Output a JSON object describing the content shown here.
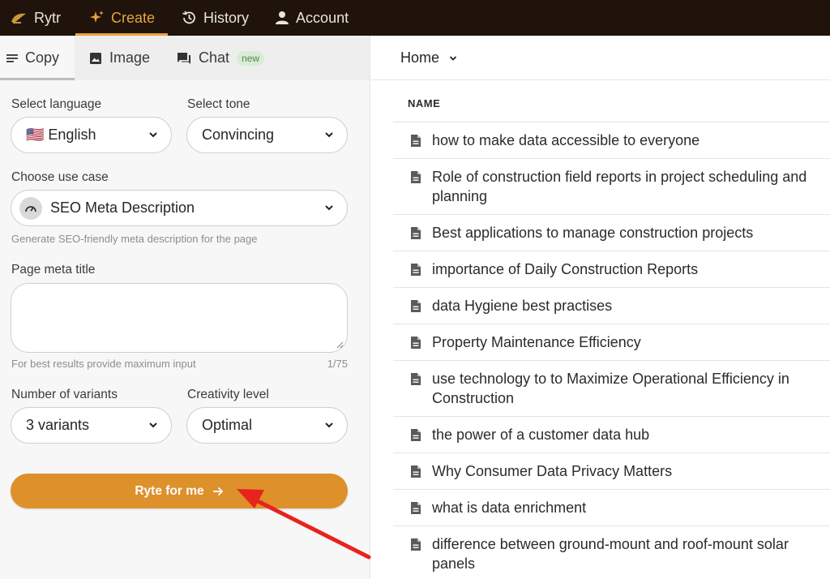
{
  "nav": {
    "brand": "Rytr",
    "items": [
      {
        "label": "Create"
      },
      {
        "label": "History"
      },
      {
        "label": "Account"
      }
    ]
  },
  "tabs": {
    "copy": "Copy",
    "image": "Image",
    "chat": "Chat",
    "chat_badge": "new"
  },
  "form": {
    "language_label": "Select language",
    "language_value": "🇺🇸 English",
    "tone_label": "Select tone",
    "tone_value": "Convincing",
    "use_case_label": "Choose use case",
    "use_case_value": "SEO Meta Description",
    "use_case_help": "Generate SEO-friendly meta description for the page",
    "meta_title_label": "Page meta title",
    "meta_title_value": "",
    "meta_title_help": "For best results provide maximum input",
    "meta_title_counter": "1/75",
    "variants_label": "Number of variants",
    "variants_value": "3 variants",
    "creativity_label": "Creativity level",
    "creativity_value": "Optimal",
    "submit_label": "Ryte for me"
  },
  "documents": {
    "breadcrumb": "Home",
    "column_header": "NAME",
    "items": [
      "how to make data accessible to everyone",
      "Role of construction field reports in project scheduling and planning",
      "Best applications to manage construction projects",
      "importance of Daily Construction Reports",
      "data Hygiene best practises",
      "Property Maintenance Efficiency",
      "use technology to to Maximize Operational Efficiency in Construction",
      "the power of a customer data hub",
      "Why Consumer Data Privacy Matters",
      "what is data enrichment",
      "difference between ground-mount and roof-mount solar panels"
    ]
  },
  "colors": {
    "nav_bg": "#1f130c",
    "accent": "#e7a43a",
    "button": "#de902b",
    "annotation_arrow": "#e8231c"
  }
}
